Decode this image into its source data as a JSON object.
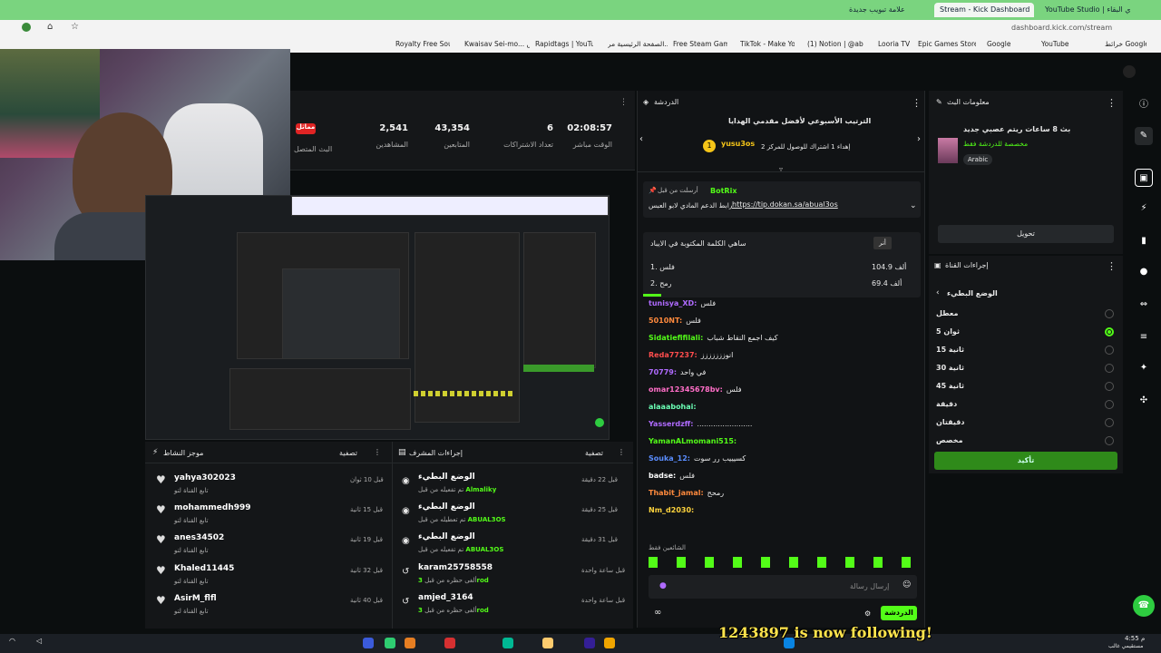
{
  "browser": {
    "tabs": [
      {
        "label": "علامة تبويب جديدة",
        "active": false
      },
      {
        "label": "Stream - Kick Dashboard",
        "active": true
      },
      {
        "label": "YouTube Studio | يحوي البقاء",
        "active": false
      }
    ],
    "address": "dashboard.kick.com/stream",
    "bookmarks": [
      "Royalty Free Sound...",
      "Kwaisav Sei-mo... أمس",
      "Rapidtags | YouTub...",
      "الصفحة الرئيسية مر...",
      "Free Steam Games",
      "TikTok - Make Your...",
      "(1) Notion | @abu...",
      "Looria TV",
      "Epic Games Store",
      "Google",
      "YouTube",
      "خرائط Google"
    ]
  },
  "stats": {
    "live_badge": "مماثل",
    "live_label": "البث المتصل",
    "items": [
      {
        "value": "2,541",
        "label": "المشاهدين"
      },
      {
        "value": "43,354",
        "label": "المتابعين"
      },
      {
        "value": "6",
        "label": "تعداد الاشتراكات"
      },
      {
        "value": "02:08:57",
        "label": "الوقت مباشر"
      }
    ]
  },
  "activity_feed": {
    "title": "موجز النشاط",
    "filter_label": "تصفية",
    "rows": [
      {
        "name": "yahya302023",
        "sub": "تابع القناة لتو",
        "time": "قبل 10 ثوان"
      },
      {
        "name": "mohammedh999",
        "sub": "تابع القناة لتو",
        "time": "قبل 15 ثانية"
      },
      {
        "name": "anes34502",
        "sub": "تابع القناة لتو",
        "time": "قبل 19 ثانية"
      },
      {
        "name": "Khaled11445",
        "sub": "تابع القناة لتو",
        "time": "قبل 32 ثانية"
      },
      {
        "name": "AsirM_flfl",
        "sub": "تابع القناة لتو",
        "time": "قبل 40 ثانية"
      }
    ]
  },
  "mod_actions": {
    "title": "إجراءات المشرف",
    "filter_label": "تصفية",
    "rows": [
      {
        "name": "الوضع البطيء",
        "sub": "تم تفعيله من قبل",
        "actor": "Almaliky",
        "time": "قبل 22 دقيقة"
      },
      {
        "name": "الوضع البطيء",
        "sub": "تم تعطيله من قبل",
        "actor": "ABUAL3OS",
        "time": "قبل 25 دقيقة"
      },
      {
        "name": "الوضع البطيء",
        "sub": "تم تفعيله من قبل",
        "actor": "ABUAL3OS",
        "time": "قبل 31 دقيقة"
      },
      {
        "name": "karam25758558",
        "sub": "ألغى حظره من قبل",
        "actor": "3rod",
        "time": "قبل ساعة واحدة"
      },
      {
        "name": "amjed_3164",
        "sub": "ألغى حظره من قبل",
        "actor": "3rod",
        "time": "قبل ساعة واحدة"
      }
    ]
  },
  "chat": {
    "title": "الدردشة",
    "leaderboard_title": "الترتيب الأسبوعي لأفضل مقدمي الهدايا",
    "top_gifter": "yusu3os",
    "top_gifter_count": "1",
    "top_gifter_note": "إهداء 1 اشتراك للوصول للمركز 2",
    "pinned_label": "أرسلت من قبل",
    "pinned_user": "BotRix",
    "pinned_text": "رابط الدعم المادي لابو العبس",
    "pinned_link": "https://tip.dokan.sa/abual3os",
    "poll_title": "ساهي الكلمة المكتوبة في الايباد",
    "poll_button": "أنر",
    "poll_options": [
      {
        "label": "1. فلس",
        "value": "104.9 ألف"
      },
      {
        "label": "2. رمح",
        "value": "69.4 ألف"
      }
    ],
    "messages": [
      {
        "user": "tunisya_XD:",
        "text": "فلس",
        "color": "#b06bff"
      },
      {
        "user": "5010NT:",
        "text": "فلس",
        "color": "#ff8a3d"
      },
      {
        "user": "Sidatiefifilali:",
        "text": "كيف اجمع النقاط شباب",
        "color": "#53fc18"
      },
      {
        "user": "Reda77237:",
        "text": "انوززززززز",
        "color": "#ff4d4d"
      },
      {
        "user": "70779:",
        "text": "في واحد",
        "color": "#b06bff"
      },
      {
        "user": "omar12345678bv:",
        "text": "فلس",
        "color": "#ff6ec7"
      },
      {
        "user": "alaaabohai:",
        "text": "",
        "color": "#6bffb5"
      },
      {
        "user": "Yasserdzff:",
        "text": "........................",
        "color": "#b06bff"
      },
      {
        "user": "YamanALmomani515:",
        "text": "",
        "color": "#53fc18"
      },
      {
        "user": "Souka_12:",
        "text": "كسيييب رر سوت",
        "color": "#5a8dff"
      },
      {
        "user": "badse:",
        "text": "فلس",
        "color": "#ffffff"
      },
      {
        "user": "Thabit_jamal:",
        "text": "رمحح",
        "color": "#ff8a3d"
      },
      {
        "user": "Nm_d2030:",
        "text": "",
        "color": "#ffd43d"
      }
    ],
    "emote_label": "الشائعين فقط",
    "input_placeholder": "إرسال رسالة",
    "send_label": "الدردشة"
  },
  "stream_info": {
    "title": "معلومات البث",
    "stream_title": "بث 8 ساعات ريتم عصبي جديد",
    "category": "مخصصة للدردشة فقط",
    "language": "Arabic",
    "edit_label": "تحويل"
  },
  "channel_actions": {
    "title": "إجراءات القناة",
    "slow_mode_title": "الوضع البطيء",
    "options": [
      {
        "label": "معطل",
        "selected": false
      },
      {
        "label": "5 ثوان",
        "selected": true
      },
      {
        "label": "15 ثانية",
        "selected": false
      },
      {
        "label": "30 ثانية",
        "selected": false
      },
      {
        "label": "45 ثانية",
        "selected": false
      },
      {
        "label": "دقيقة",
        "selected": false
      },
      {
        "label": "دقيقتان",
        "selected": false
      },
      {
        "label": "مخصص",
        "selected": false
      }
    ],
    "confirm_label": "تأكيد"
  },
  "overlay": {
    "follow_text": "1243897 is now following!"
  },
  "taskbar": {
    "time": "4:55 م",
    "date": "مستقيمي غالب"
  },
  "colors": {
    "accent": "#53fc18",
    "tabbar": "#7ad47f",
    "panel": "#141618"
  }
}
